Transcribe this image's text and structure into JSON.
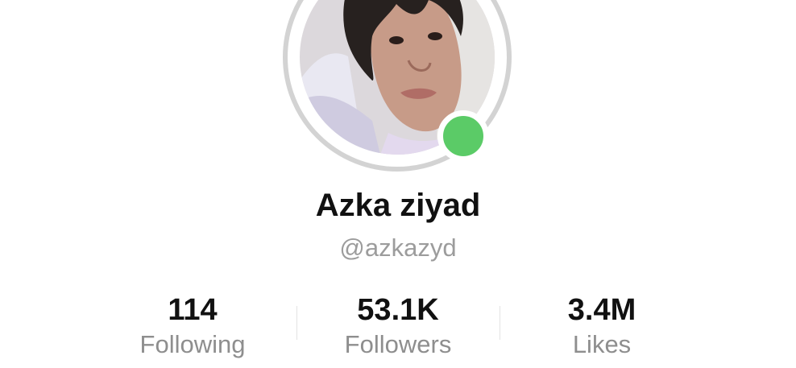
{
  "profile": {
    "display_name": "Azka ziyad",
    "username": "@azkazyd",
    "online_status_color": "#5bcb67",
    "avatar_icon": "profile-photo"
  },
  "stats": [
    {
      "value": "114",
      "label": "Following"
    },
    {
      "value": "53.1K",
      "label": "Followers"
    },
    {
      "value": "3.4M",
      "label": "Likes"
    }
  ]
}
